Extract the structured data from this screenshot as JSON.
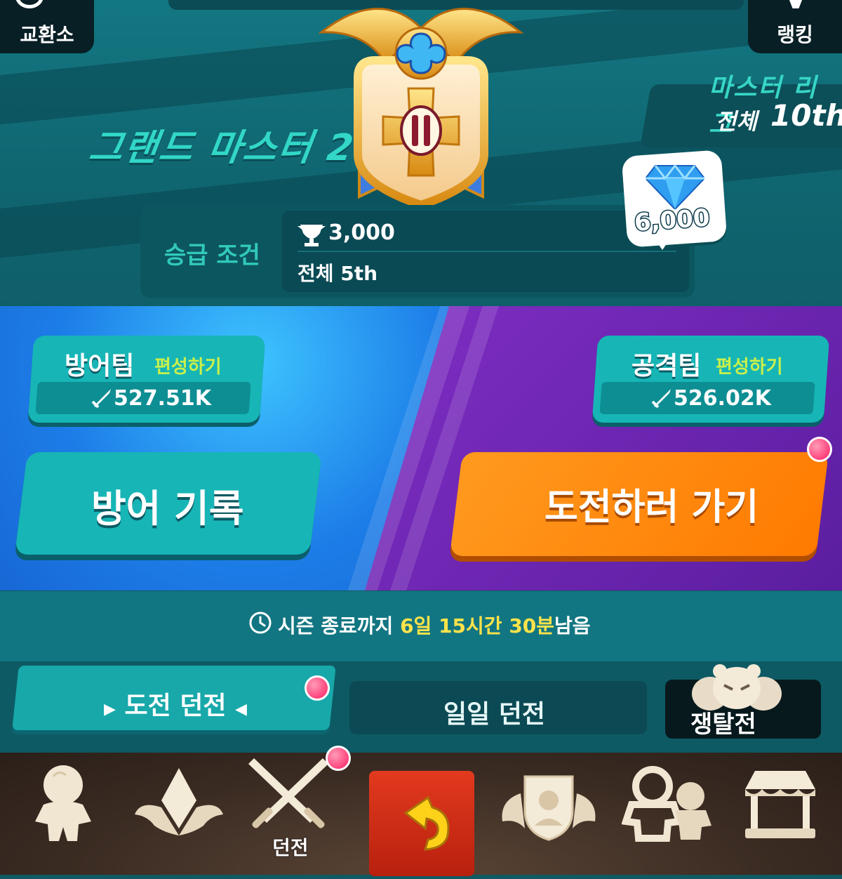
{
  "topbar": {
    "exchange_label": "교환소",
    "ranking_label": "랭킹"
  },
  "league": {
    "name": "마스터 리그",
    "rank_label": "전체",
    "rank_value": "10th"
  },
  "grade": {
    "name": "그랜드 마스터 2",
    "emblem_icon": "grand-master-shield-emblem"
  },
  "promotion": {
    "label": "승급 조건",
    "trophy_icon": "trophy-icon",
    "trophy_value": "3,000",
    "rank_condition": "전체 5th",
    "reward_icon": "diamond-crystal-icon",
    "reward_value": "6,000"
  },
  "defense_team": {
    "title": "방어팀",
    "edit_label": "편성하기",
    "power": "527.51K",
    "log_button": "방어 기록"
  },
  "attack_team": {
    "title": "공격팀",
    "edit_label": "편성하기",
    "power": "526.02K",
    "challenge_button": "도전하러 가기"
  },
  "season": {
    "prefix": "시즌 종료까지",
    "days": "6일",
    "hours": "15시간",
    "minutes": "30분",
    "suffix": "남음"
  },
  "tabs": {
    "challenge": "도전 던전",
    "daily": "일일 던전",
    "war": "쟁탈전"
  },
  "bottom_nav": {
    "dungeon_label": "던전",
    "items": [
      "cookie-icon",
      "treasure-wing-icon",
      "dungeon-swords-icon",
      "return-arrow-icon",
      "guild-shield-icon",
      "kingdom-cookies-icon",
      "shop-stall-icon"
    ]
  },
  "colors": {
    "teal_panel": "#137782",
    "teal_button": "#17b5b6",
    "orange_button": "#ff8a10",
    "highlight_yellow": "#ffe34a",
    "edit_green": "#c8f04c",
    "notification_pink": "#ff1b63"
  }
}
